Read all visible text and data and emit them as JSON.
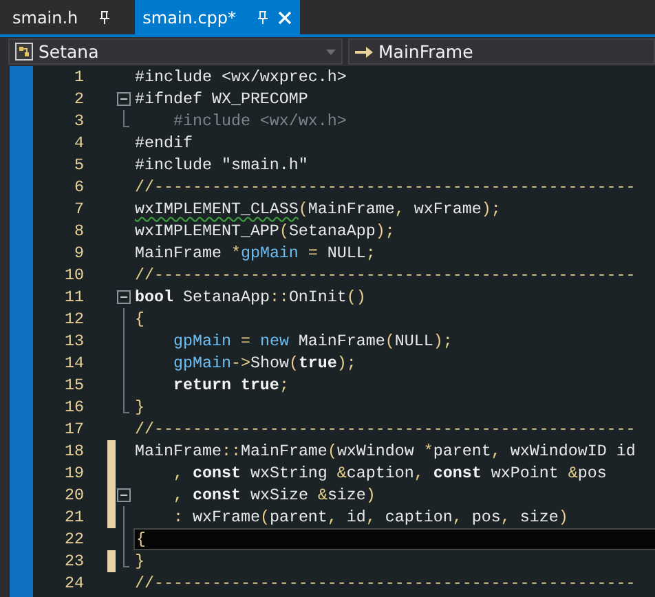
{
  "tabs": [
    {
      "label": "smain.h",
      "selected": false,
      "closable": false
    },
    {
      "label": "smain.cpp*",
      "selected": true,
      "closable": true
    }
  ],
  "navigation": {
    "scope": "Setana",
    "member": "MainFrame"
  },
  "lines": [
    {
      "number": "1",
      "changed": false,
      "current": false,
      "fold_toggle": false,
      "fold_guide": false,
      "fold_end": false,
      "tokens": [
        {
          "kind": "text",
          "t": "#include <wx/wxprec.h>"
        }
      ]
    },
    {
      "number": "2",
      "changed": false,
      "current": false,
      "fold_toggle": true,
      "fold_guide": false,
      "fold_end": false,
      "tokens": [
        {
          "kind": "text",
          "t": "#ifndef WX_PRECOMP"
        }
      ]
    },
    {
      "number": "3",
      "changed": false,
      "current": false,
      "fold_toggle": false,
      "fold_guide": true,
      "fold_end": true,
      "tokens": [
        {
          "kind": "inactive",
          "t": "    #include <wx/wx.h>"
        }
      ]
    },
    {
      "number": "4",
      "changed": false,
      "current": false,
      "fold_toggle": false,
      "fold_guide": false,
      "fold_end": false,
      "tokens": [
        {
          "kind": "text",
          "t": "#endif"
        }
      ]
    },
    {
      "number": "5",
      "changed": false,
      "current": false,
      "fold_toggle": false,
      "fold_guide": false,
      "fold_end": false,
      "tokens": [
        {
          "kind": "text",
          "t": "#include \"smain.h\""
        }
      ]
    },
    {
      "number": "6",
      "changed": false,
      "current": false,
      "fold_toggle": false,
      "fold_guide": false,
      "fold_end": false,
      "tokens": [
        {
          "kind": "comment",
          "t": "//--------------------------------------------------"
        }
      ]
    },
    {
      "number": "7",
      "changed": false,
      "current": false,
      "fold_toggle": false,
      "fold_guide": false,
      "fold_end": false,
      "tokens": [
        {
          "kind": "warning",
          "t": "wxIMPLEMENT_CLASS"
        },
        {
          "kind": "punct",
          "t": "("
        },
        {
          "kind": "text",
          "t": "MainFrame"
        },
        {
          "kind": "punct",
          "t": ","
        },
        {
          "kind": "text",
          "t": " wxFrame"
        },
        {
          "kind": "punct",
          "t": ");"
        }
      ]
    },
    {
      "number": "8",
      "changed": false,
      "current": false,
      "fold_toggle": false,
      "fold_guide": false,
      "fold_end": false,
      "tokens": [
        {
          "kind": "text",
          "t": "wxIMPLEMENT_APP"
        },
        {
          "kind": "punct",
          "t": "("
        },
        {
          "kind": "text",
          "t": "SetanaApp"
        },
        {
          "kind": "punct",
          "t": ");"
        }
      ]
    },
    {
      "number": "9",
      "changed": false,
      "current": false,
      "fold_toggle": false,
      "fold_guide": false,
      "fold_end": false,
      "tokens": [
        {
          "kind": "text",
          "t": "MainFrame "
        },
        {
          "kind": "punct",
          "t": "*"
        },
        {
          "kind": "ident",
          "t": "gpMain"
        },
        {
          "kind": "punct",
          "t": " ="
        },
        {
          "kind": "text",
          "t": " NULL"
        },
        {
          "kind": "punct",
          "t": ";"
        }
      ]
    },
    {
      "number": "10",
      "changed": false,
      "current": false,
      "fold_toggle": false,
      "fold_guide": false,
      "fold_end": false,
      "tokens": [
        {
          "kind": "comment",
          "t": "//--------------------------------------------------"
        }
      ]
    },
    {
      "number": "11",
      "changed": false,
      "current": false,
      "fold_toggle": true,
      "fold_guide": false,
      "fold_end": false,
      "tokens": [
        {
          "kind": "keyword",
          "t": "bool"
        },
        {
          "kind": "text",
          "t": " SetanaApp"
        },
        {
          "kind": "punct",
          "t": "::"
        },
        {
          "kind": "text",
          "t": "OnInit"
        },
        {
          "kind": "punct",
          "t": "()"
        }
      ]
    },
    {
      "number": "12",
      "changed": false,
      "current": false,
      "fold_toggle": false,
      "fold_guide": true,
      "fold_end": false,
      "tokens": [
        {
          "kind": "punct",
          "t": "{"
        }
      ]
    },
    {
      "number": "13",
      "changed": false,
      "current": false,
      "fold_toggle": false,
      "fold_guide": true,
      "fold_end": false,
      "tokens": [
        {
          "kind": "ident",
          "t": "    gpMain"
        },
        {
          "kind": "punct",
          "t": " ="
        },
        {
          "kind": "ident",
          "t": " new"
        },
        {
          "kind": "text",
          "t": " MainFrame"
        },
        {
          "kind": "punct",
          "t": "("
        },
        {
          "kind": "text",
          "t": "NULL"
        },
        {
          "kind": "punct",
          "t": ");"
        }
      ]
    },
    {
      "number": "14",
      "changed": false,
      "current": false,
      "fold_toggle": false,
      "fold_guide": true,
      "fold_end": false,
      "tokens": [
        {
          "kind": "ident",
          "t": "    gpMain"
        },
        {
          "kind": "punct",
          "t": "->"
        },
        {
          "kind": "text",
          "t": "Show"
        },
        {
          "kind": "punct",
          "t": "("
        },
        {
          "kind": "keyword",
          "t": "true"
        },
        {
          "kind": "punct",
          "t": ");"
        }
      ]
    },
    {
      "number": "15",
      "changed": false,
      "current": false,
      "fold_toggle": false,
      "fold_guide": true,
      "fold_end": false,
      "tokens": [
        {
          "kind": "keyword",
          "t": "    return true"
        },
        {
          "kind": "punct",
          "t": ";"
        }
      ]
    },
    {
      "number": "16",
      "changed": false,
      "current": false,
      "fold_toggle": false,
      "fold_guide": true,
      "fold_end": true,
      "tokens": [
        {
          "kind": "punct",
          "t": "}"
        }
      ]
    },
    {
      "number": "17",
      "changed": false,
      "current": false,
      "fold_toggle": false,
      "fold_guide": false,
      "fold_end": false,
      "tokens": [
        {
          "kind": "comment",
          "t": "//--------------------------------------------------"
        }
      ]
    },
    {
      "number": "18",
      "changed": true,
      "current": false,
      "fold_toggle": false,
      "fold_guide": false,
      "fold_end": false,
      "tokens": [
        {
          "kind": "text",
          "t": "MainFrame"
        },
        {
          "kind": "punct",
          "t": "::"
        },
        {
          "kind": "text",
          "t": "MainFrame"
        },
        {
          "kind": "punct",
          "t": "("
        },
        {
          "kind": "text",
          "t": "wxWindow "
        },
        {
          "kind": "punct",
          "t": "*"
        },
        {
          "kind": "text",
          "t": "parent"
        },
        {
          "kind": "punct",
          "t": ","
        },
        {
          "kind": "text",
          "t": " wxWindowID id"
        }
      ]
    },
    {
      "number": "19",
      "changed": true,
      "current": false,
      "fold_toggle": false,
      "fold_guide": false,
      "fold_end": false,
      "tokens": [
        {
          "kind": "punct",
          "t": "    ,"
        },
        {
          "kind": "keyword",
          "t": " const"
        },
        {
          "kind": "text",
          "t": " wxString "
        },
        {
          "kind": "punct",
          "t": "&"
        },
        {
          "kind": "text",
          "t": "caption"
        },
        {
          "kind": "punct",
          "t": ","
        },
        {
          "kind": "keyword",
          "t": " const"
        },
        {
          "kind": "text",
          "t": " wxPoint "
        },
        {
          "kind": "punct",
          "t": "&"
        },
        {
          "kind": "text",
          "t": "pos"
        }
      ]
    },
    {
      "number": "20",
      "changed": true,
      "current": false,
      "fold_toggle": true,
      "fold_guide": false,
      "fold_end": false,
      "tokens": [
        {
          "kind": "punct",
          "t": "    ,"
        },
        {
          "kind": "keyword",
          "t": " const"
        },
        {
          "kind": "text",
          "t": " wxSize "
        },
        {
          "kind": "punct",
          "t": "&"
        },
        {
          "kind": "text",
          "t": "size"
        },
        {
          "kind": "punct",
          "t": ")"
        }
      ]
    },
    {
      "number": "21",
      "changed": true,
      "current": false,
      "fold_toggle": false,
      "fold_guide": true,
      "fold_end": false,
      "tokens": [
        {
          "kind": "punct",
          "t": "    :"
        },
        {
          "kind": "text",
          "t": " wxFrame"
        },
        {
          "kind": "punct",
          "t": "("
        },
        {
          "kind": "text",
          "t": "parent"
        },
        {
          "kind": "punct",
          "t": ","
        },
        {
          "kind": "text",
          "t": " id"
        },
        {
          "kind": "punct",
          "t": ","
        },
        {
          "kind": "text",
          "t": " caption"
        },
        {
          "kind": "punct",
          "t": ","
        },
        {
          "kind": "text",
          "t": " pos"
        },
        {
          "kind": "punct",
          "t": ","
        },
        {
          "kind": "text",
          "t": " size"
        },
        {
          "kind": "punct",
          "t": ")"
        }
      ]
    },
    {
      "number": "22",
      "changed": false,
      "current": true,
      "fold_toggle": false,
      "fold_guide": true,
      "fold_end": false,
      "tokens": [
        {
          "kind": "punct",
          "t": "{"
        }
      ]
    },
    {
      "number": "23",
      "changed": true,
      "current": false,
      "fold_toggle": false,
      "fold_guide": true,
      "fold_end": true,
      "tokens": [
        {
          "kind": "punct",
          "t": "}"
        }
      ]
    },
    {
      "number": "24",
      "changed": false,
      "current": false,
      "fold_toggle": false,
      "fold_guide": false,
      "fold_end": false,
      "tokens": [
        {
          "kind": "comment",
          "t": "//--------------------------------------------------"
        }
      ]
    }
  ]
}
